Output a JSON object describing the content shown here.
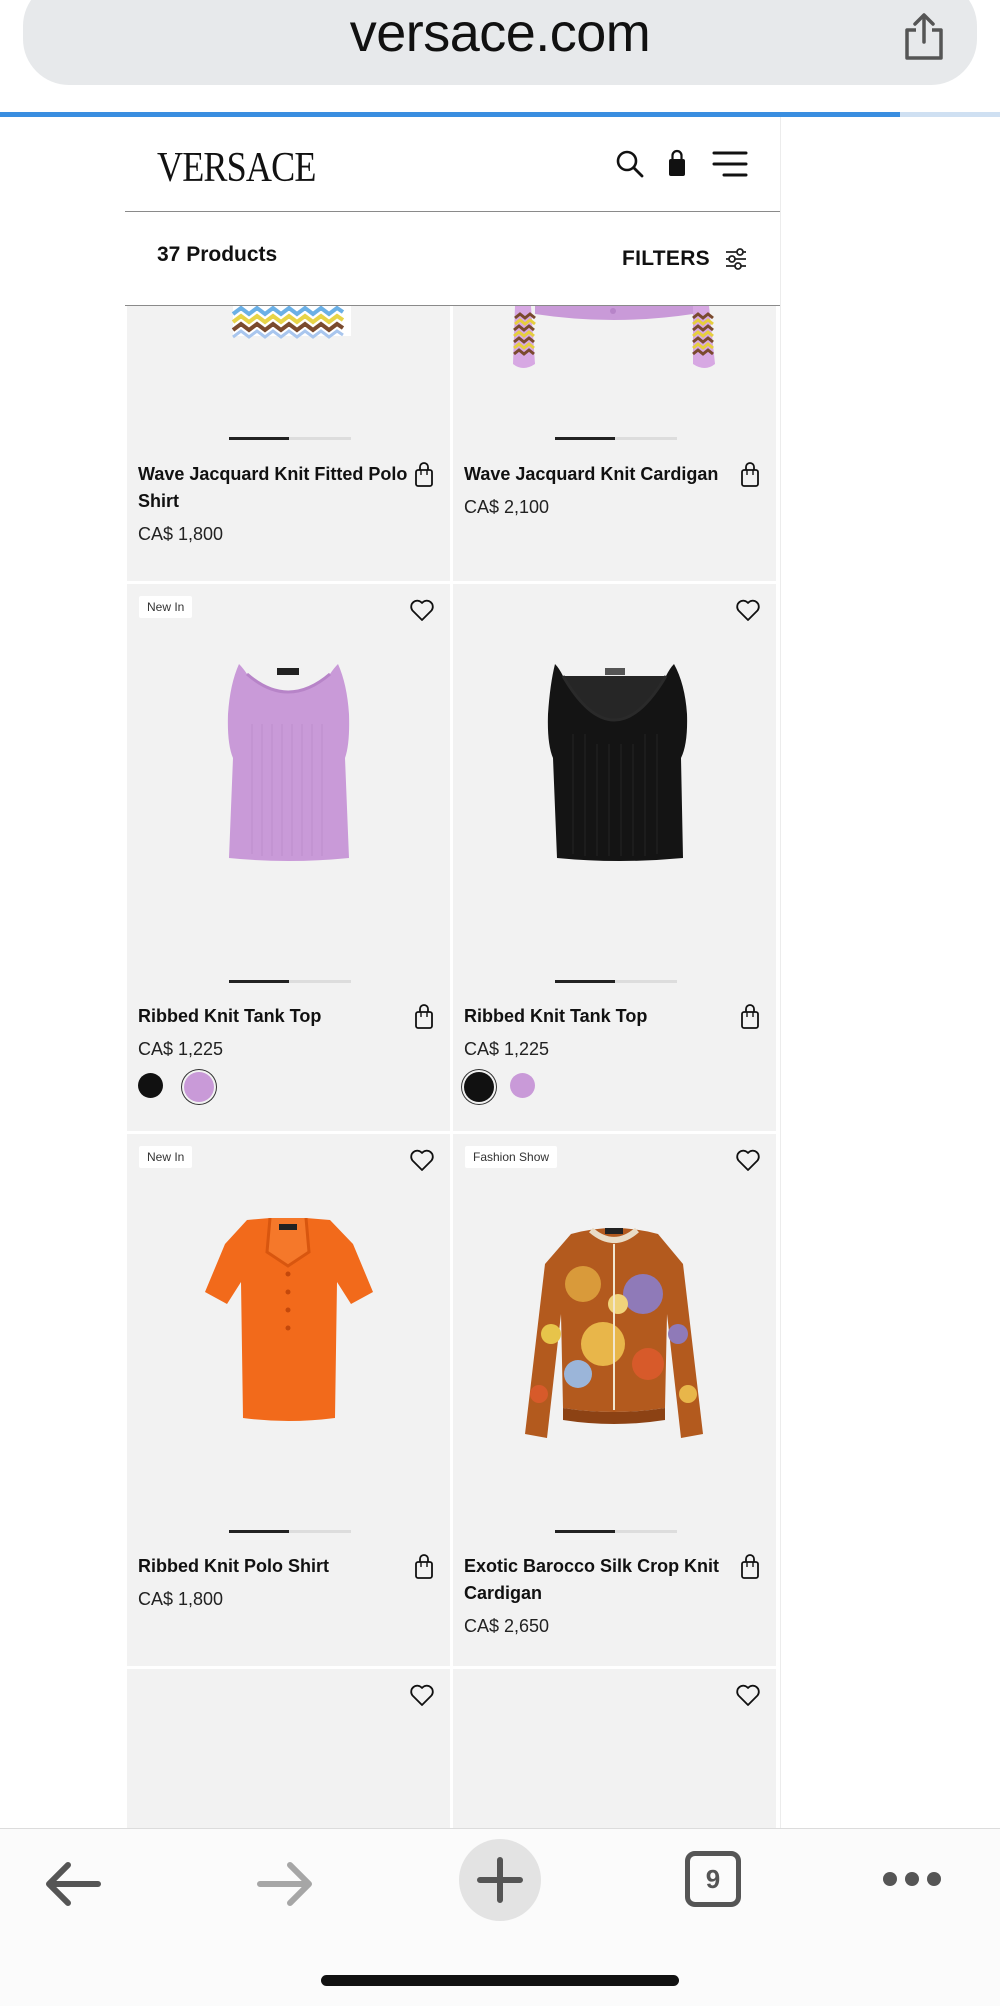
{
  "browser": {
    "url": "versace.com",
    "load_progress": 0.9,
    "tabs_count": "9"
  },
  "site": {
    "logo": "VERSACE",
    "product_count": "37 Products",
    "filters_label": "FILTERS"
  },
  "products": [
    {
      "name_line1": "Wave Jacquard Knit Fitted Polo",
      "name_line2": "Shirt",
      "price": "CA$ 1,800",
      "badge": ""
    },
    {
      "name_line1": "Wave Jacquard Knit Cardigan",
      "name_line2": "",
      "price": "CA$ 2,100",
      "badge": ""
    },
    {
      "name_line1": "Ribbed Knit Tank Top",
      "name_line2": "",
      "price": "CA$ 1,225",
      "badge": "New In",
      "swatches": [
        "#111111",
        "#c99ad8"
      ],
      "selected_swatch": 1
    },
    {
      "name_line1": "Ribbed Knit Tank Top",
      "name_line2": "",
      "price": "CA$ 1,225",
      "badge": "",
      "swatches": [
        "#111111",
        "#c99ad8"
      ],
      "selected_swatch": 0
    },
    {
      "name_line1": "Ribbed Knit Polo Shirt",
      "name_line2": "",
      "price": "CA$ 1,800",
      "badge": "New In"
    },
    {
      "name_line1": "Exotic Barocco Silk Crop Knit",
      "name_line2": "Cardigan",
      "price": "CA$ 2,650",
      "badge": "Fashion Show"
    }
  ],
  "colors": {
    "accent_blue": "#3a8ee0",
    "card_bg": "#f2f2f2",
    "lilac": "#c99ad8",
    "orange": "#f26a1b",
    "black": "#111111"
  },
  "icons": {
    "share": "share-icon",
    "search": "search-icon",
    "bag": "shopping-bag-icon",
    "menu": "hamburger-menu-icon",
    "filters": "sliders-icon",
    "heart": "heart-icon",
    "back": "arrow-left-icon",
    "forward": "arrow-right-icon",
    "new_tab": "plus-icon",
    "tabs": "tab-count-icon",
    "more": "more-dots-icon"
  }
}
